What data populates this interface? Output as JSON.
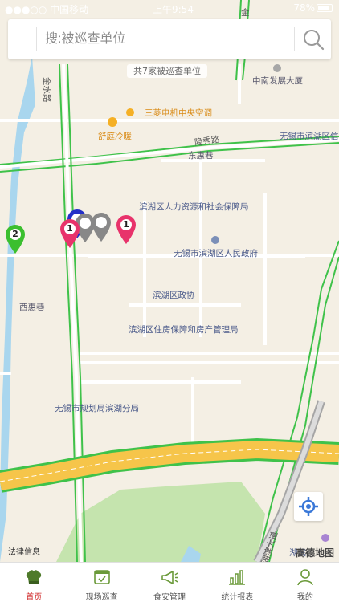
{
  "status_bar": {
    "carrier": "●●●○○ 中国移动",
    "time": "上午9:54",
    "battery": "78%"
  },
  "search": {
    "placeholder": "搜:被巡查单位",
    "value": ""
  },
  "unit_count": "共7家被巡查单位",
  "map_labels": {
    "jinshui_road": "金水路",
    "jin_road_top": "金",
    "zhongnan": "中南发展大厦",
    "mitsubishi": "三菱电机中央空调",
    "shuting": "舒庭冷暖",
    "yinxiu_road": "隐秀路",
    "binhu_district_short": "无锡市滨湖区信",
    "donghui_lane": "东惠巷",
    "hr_bureau": "滨湖区人力资源和社会保障局",
    "gov": "无锡市滨湖区人民政府",
    "xihui_lane": "西惠巷",
    "cppcc": "滨湖区政协",
    "housing": "滨湖区住房保障和房产管理局",
    "planning": "无锡市规划局滨湖分局",
    "hubin_road": "湖滨大道",
    "lake_edge": "湖滨"
  },
  "markers": [
    {
      "label": "2",
      "color": "#3bbf2f"
    },
    {
      "label": "1",
      "color": "#e8336b"
    },
    {
      "label": "1",
      "color": "#e8336b"
    },
    {
      "label": "",
      "color": "#888888"
    },
    {
      "label": "",
      "color": "#888888"
    },
    {
      "label": "",
      "color": "#2430c8"
    }
  ],
  "legal": "法律信息",
  "map_brand": "高德地图",
  "tabs": [
    {
      "label": "首页",
      "icon": "chef-hat-icon",
      "active": true
    },
    {
      "label": "现场巡查",
      "icon": "inspection-board-icon",
      "active": false
    },
    {
      "label": "食安管理",
      "icon": "megaphone-icon",
      "active": false
    },
    {
      "label": "统计报表",
      "icon": "bar-chart-icon",
      "active": false
    },
    {
      "label": "我的",
      "icon": "user-icon",
      "active": false
    }
  ],
  "colors": {
    "accent": "#d12f2f",
    "road_green": "#3fc24a",
    "highway_yellow": "#f6c54a",
    "water": "#a9d6ee",
    "park": "#c5e4ae"
  }
}
